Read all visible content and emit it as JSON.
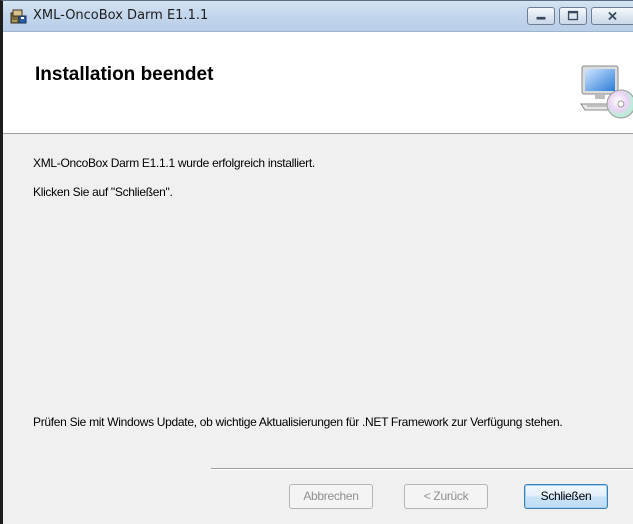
{
  "window": {
    "title": "XML-OncoBox Darm E1.1.1",
    "controls": {
      "minimize": "minimize-icon",
      "maximize": "maximize-icon",
      "close": "close-icon"
    }
  },
  "banner": {
    "title": "Installation beendet",
    "graphic": "computer-cd-icon"
  },
  "content": {
    "success_message": "XML-OncoBox Darm E1.1.1 wurde erfolgreich installiert.",
    "instruction": "Klicken Sie auf \"Schließen\".",
    "update_note": "Prüfen Sie mit Windows Update, ob wichtige Aktualisierungen für .NET Framework zur Verfügung stehen."
  },
  "buttons": {
    "cancel": "Abbrechen",
    "back": "< Zurück",
    "finish": "Schließen"
  },
  "colors": {
    "titlebar": "#c3d6ec",
    "dialog_bg": "#f0f0f0",
    "banner_bg": "#ffffff",
    "default_button_border": "#3c7fb1"
  }
}
